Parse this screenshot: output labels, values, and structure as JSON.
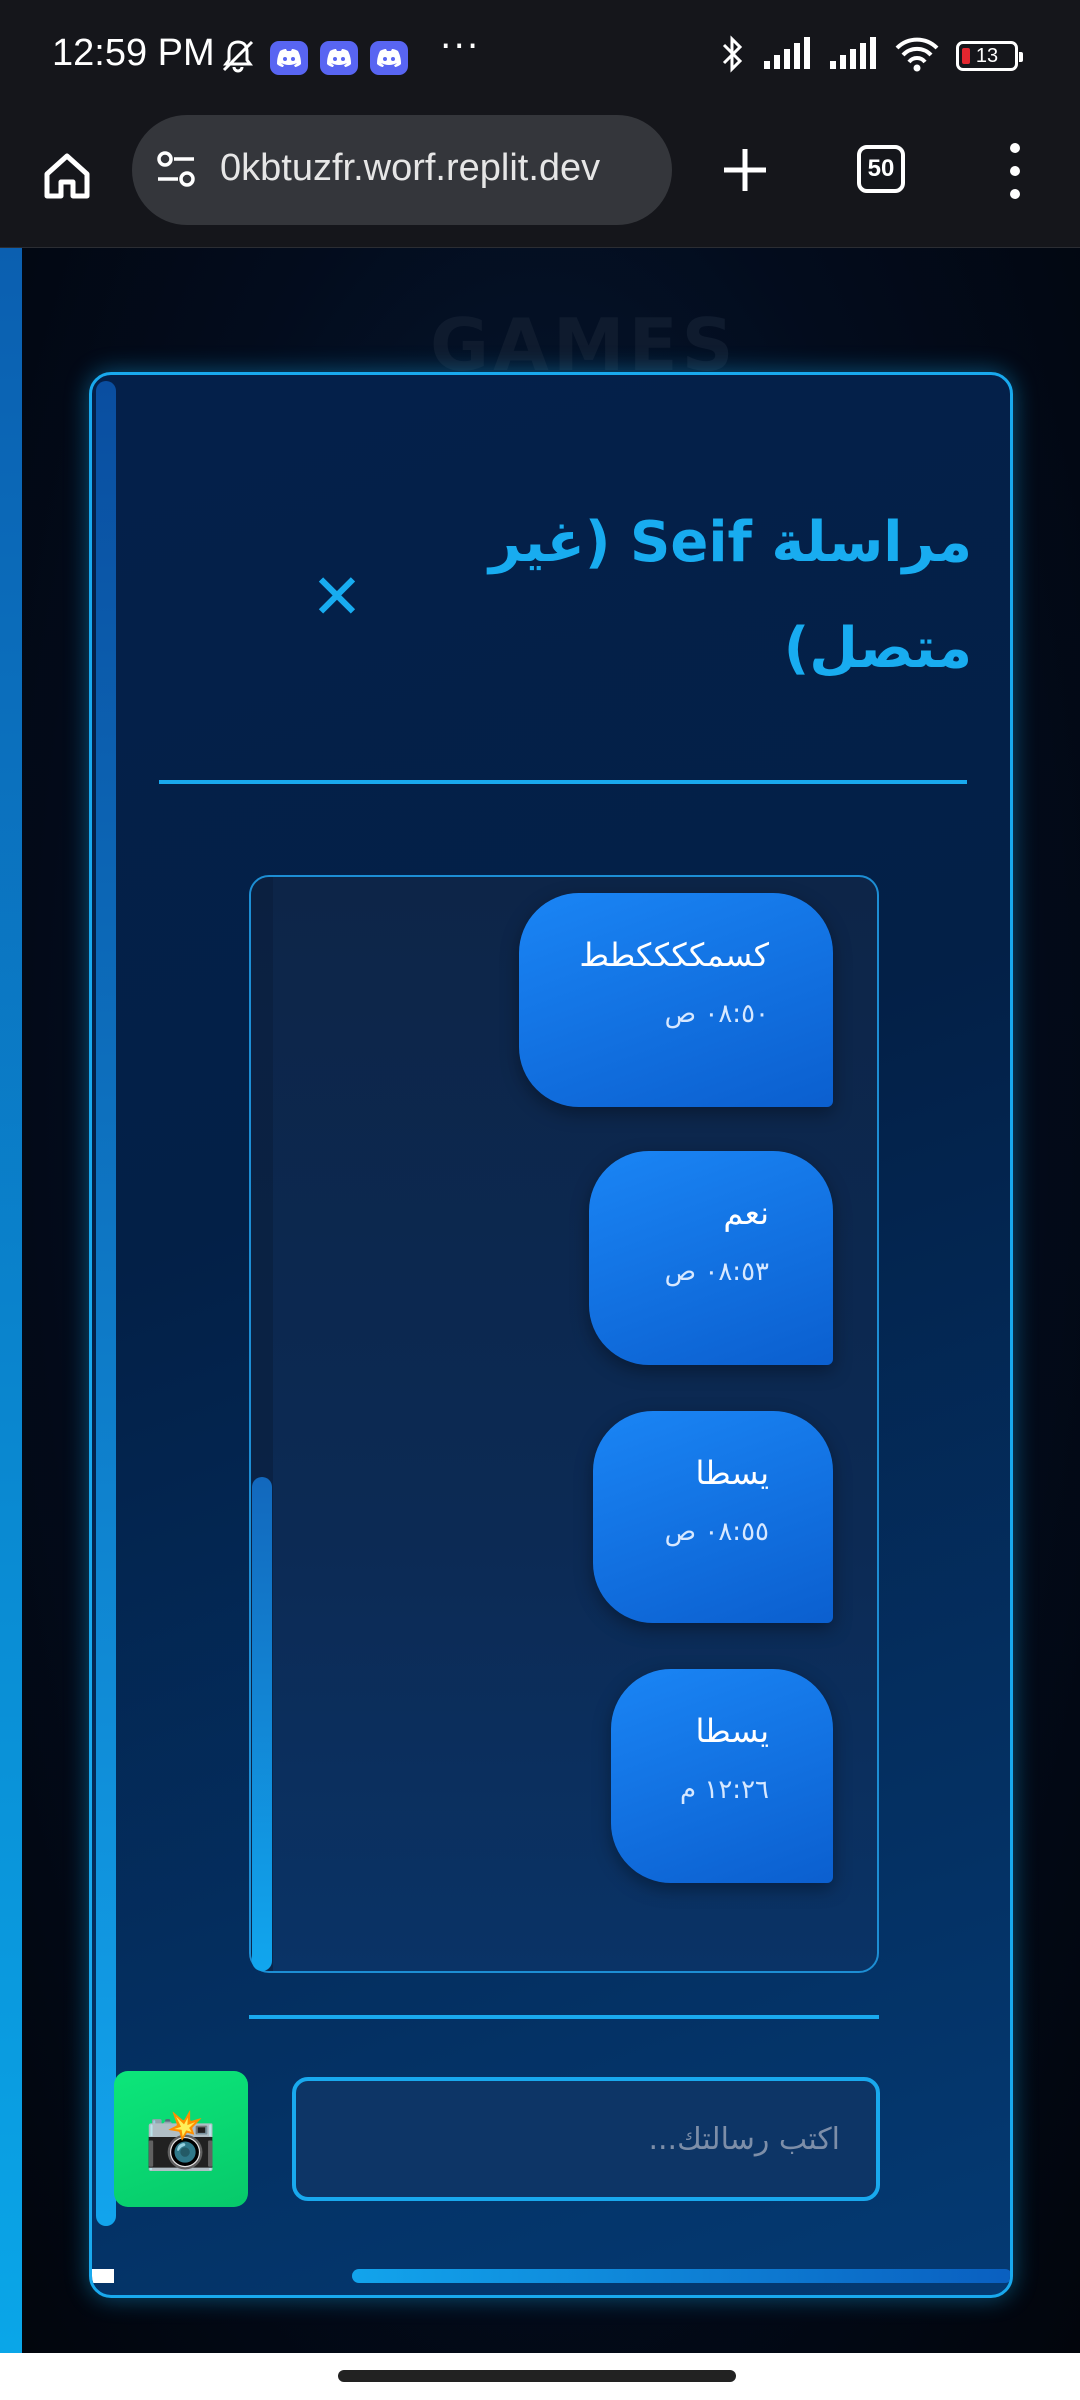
{
  "status_bar": {
    "time": "12:59 PM",
    "icons": [
      "mute-icon",
      "discord-icon",
      "discord-icon",
      "discord-icon",
      "more-icon",
      "bluetooth-icon",
      "signal-icon",
      "signal-icon",
      "wifi-icon"
    ],
    "battery": "13",
    "more": "···"
  },
  "browser": {
    "url": "‎0kbtuzfr.worf.replit.dev",
    "tab_count": "50"
  },
  "chat": {
    "title": "مراسلة Seif (غير متصل)",
    "close_label": "✕",
    "messages": [
      {
        "text": "كسمككككطط",
        "time": "٠٨:٥٠ ص"
      },
      {
        "text": "نعم",
        "time": "٠٨:٥٣ ص"
      },
      {
        "text": "يسطا",
        "time": "٠٨:٥٥ ص"
      },
      {
        "text": "يسطا",
        "time": "١٢:٢٦ م"
      }
    ],
    "input_placeholder": "اكتب رسالتك...",
    "input_value": "",
    "camera_label": "📸"
  },
  "background": {
    "heading": "GAMES"
  },
  "colors": {
    "accent": "#19a9ee",
    "bubble": "#1a85f5",
    "camera_button": "#0ce67a",
    "discord": "#5865f2"
  }
}
